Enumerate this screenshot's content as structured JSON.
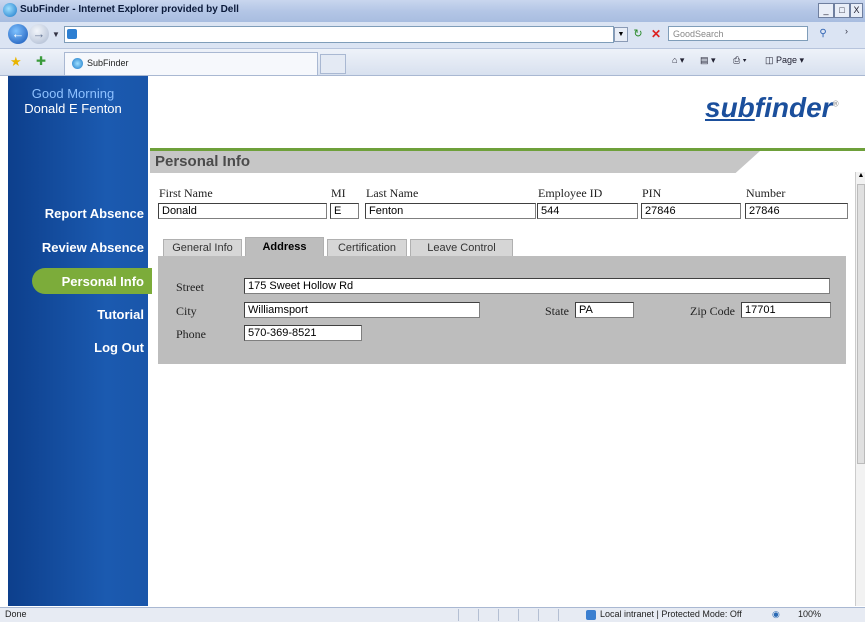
{
  "window": {
    "title": "SubFinder - Internet Explorer provided by Dell",
    "min": "_",
    "max": "□",
    "close": "X"
  },
  "toolbar": {
    "search_placeholder": "GoodSearch",
    "tab_label": "SubFinder",
    "home_icon": "home-icon",
    "page_menu": "Page"
  },
  "sidebar": {
    "greeting": "Good Morning",
    "user": "Donald E Fenton",
    "items": [
      {
        "label": "Report Absence"
      },
      {
        "label": "Review Absence"
      },
      {
        "label": "Personal Info",
        "active": true
      },
      {
        "label": "Tutorial"
      },
      {
        "label": "Log Out"
      }
    ],
    "active_color": "#7cac3a"
  },
  "logo": {
    "part1": "sub",
    "part2": "finder",
    "mark": "®"
  },
  "section": {
    "title": "Personal Info"
  },
  "fields": {
    "first_name_label": "First Name",
    "first_name": "Donald",
    "mi_label": "MI",
    "mi": "E",
    "last_name_label": "Last Name",
    "last_name": "Fenton",
    "employee_id_label": "Employee ID",
    "employee_id": "544",
    "pin_label": "PIN",
    "pin": "27846",
    "number_label": "Number",
    "number": "27846"
  },
  "tabs": [
    {
      "label": "General Info"
    },
    {
      "label": "Address",
      "active": true
    },
    {
      "label": "Certification"
    },
    {
      "label": "Leave Control"
    }
  ],
  "address": {
    "street_label": "Street",
    "street": "175 Sweet Hollow Rd",
    "city_label": "City",
    "city": "Williamsport",
    "state_label": "State",
    "state": "PA",
    "zip_label": "Zip Code",
    "zip": "17701",
    "phone_label": "Phone",
    "phone": "570-369-8521"
  },
  "statusbar": {
    "status": "Done",
    "zone": "Local intranet | Protected Mode: Off",
    "zoom": "100%"
  }
}
